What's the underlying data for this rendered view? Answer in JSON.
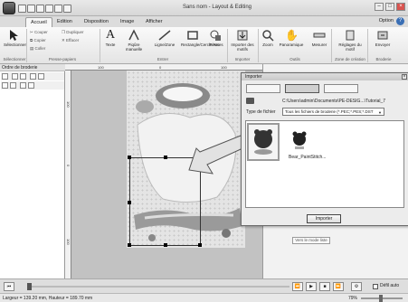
{
  "window": {
    "title": "Sans nom - Layout & Editing"
  },
  "tabs": [
    "Accueil",
    "Edition",
    "Disposition",
    "Image",
    "Afficher"
  ],
  "option_label": "Option",
  "ribbon": {
    "select_label": "Sélectionner",
    "cut": "Couper",
    "copy": "Copier",
    "paste": "Coller",
    "duplicate": "Dupliquer",
    "erase": "Effacer",
    "text": "Texte",
    "motif": "Piqûre manuelle",
    "line": "Ligne/Zone",
    "rect": "Rectangle/Cercle/Arc",
    "shapes": "Formes",
    "import": "Importer des motifs",
    "zoom": "Zoom",
    "pan": "Panoramique",
    "measure": "Mesurer",
    "settings": "Réglages du motif",
    "send": "Envoyer",
    "groups": [
      "Sélectionner",
      "Presse-papiers",
      "Entrer",
      "Importer",
      "Outils",
      "Zone de création",
      "Broderie"
    ]
  },
  "left_panel": {
    "title": "Ordre de broderie"
  },
  "rulers": {
    "h": [
      "100",
      "0",
      "100"
    ],
    "v": [
      "100",
      "0",
      "100"
    ]
  },
  "dialog": {
    "title": "Importer",
    "path": "C:\\Users\\admin\\Documents\\PE-DESIG...\\Tutorial_7",
    "type_label": "Type de fichier",
    "type_value": "Tous les fichiers de broderie (*.PEC;*.PES;*.DST",
    "file_name": "Bear_PaintStitch...",
    "import_button": "Importer"
  },
  "right_panel": {
    "view_button": "Vers le mode liste"
  },
  "bottom": {
    "checkbox_label": "Défil auto"
  },
  "status": {
    "text": "Largeur = 139.20 mm, Hauteur = 189.70 mm",
    "zoom": "79%"
  }
}
